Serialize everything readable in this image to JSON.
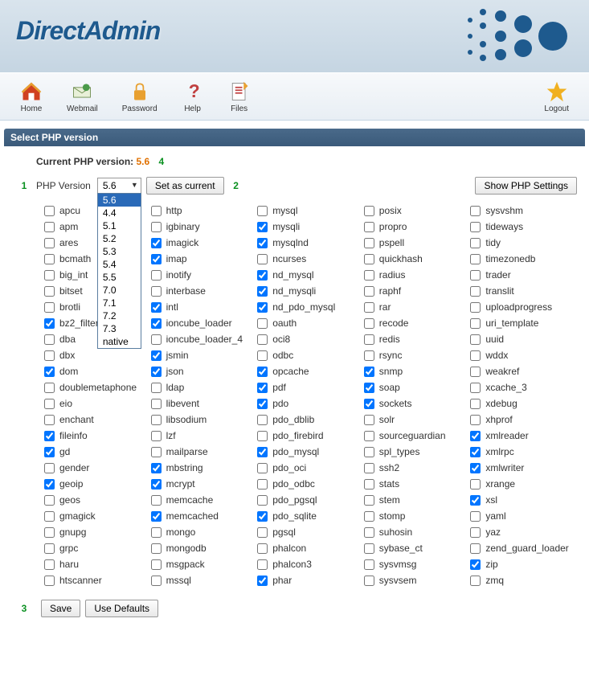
{
  "brand": "DirectAdmin",
  "toolbar": {
    "home": "Home",
    "webmail": "Webmail",
    "password": "Password",
    "help": "Help",
    "files": "Files",
    "logout": "Logout"
  },
  "panel": {
    "title": "Select PHP version"
  },
  "current": {
    "label": "Current PHP version:",
    "value": "5.6"
  },
  "markers": {
    "m1": "1",
    "m2": "2",
    "m3": "3",
    "m4": "4"
  },
  "selector": {
    "label": "PHP Version",
    "value": "5.6",
    "options": [
      "5.6",
      "4.4",
      "5.1",
      "5.2",
      "5.3",
      "5.4",
      "5.5",
      "7.0",
      "7.1",
      "7.2",
      "7.3",
      "native"
    ]
  },
  "buttons": {
    "set_current": "Set as current",
    "show_settings": "Show PHP Settings",
    "save": "Save",
    "use_defaults": "Use Defaults"
  },
  "extensions": {
    "col1": [
      {
        "name": "apcu",
        "checked": false
      },
      {
        "name": "apm",
        "checked": false
      },
      {
        "name": "ares",
        "checked": false
      },
      {
        "name": "bcmath",
        "checked": false
      },
      {
        "name": "big_int",
        "checked": false
      },
      {
        "name": "bitset",
        "checked": false
      },
      {
        "name": "brotli",
        "checked": false
      },
      {
        "name": "bz2_filter",
        "checked": true
      },
      {
        "name": "dba",
        "checked": false
      },
      {
        "name": "dbx",
        "checked": false
      },
      {
        "name": "dom",
        "checked": true
      },
      {
        "name": "doublemetaphone",
        "checked": false
      },
      {
        "name": "eio",
        "checked": false
      },
      {
        "name": "enchant",
        "checked": false
      },
      {
        "name": "fileinfo",
        "checked": true
      },
      {
        "name": "gd",
        "checked": true
      },
      {
        "name": "gender",
        "checked": false
      },
      {
        "name": "geoip",
        "checked": true
      },
      {
        "name": "geos",
        "checked": false
      },
      {
        "name": "gmagick",
        "checked": false
      },
      {
        "name": "gnupg",
        "checked": false
      },
      {
        "name": "grpc",
        "checked": false
      },
      {
        "name": "haru",
        "checked": false
      },
      {
        "name": "htscanner",
        "checked": false
      }
    ],
    "col2": [
      {
        "name": "http",
        "checked": false
      },
      {
        "name": "igbinary",
        "checked": false
      },
      {
        "name": "imagick",
        "checked": true
      },
      {
        "name": "imap",
        "checked": true
      },
      {
        "name": "inotify",
        "checked": false
      },
      {
        "name": "interbase",
        "checked": false
      },
      {
        "name": "intl",
        "checked": true
      },
      {
        "name": "ioncube_loader",
        "checked": true
      },
      {
        "name": "ioncube_loader_4",
        "checked": false
      },
      {
        "name": "jsmin",
        "checked": true
      },
      {
        "name": "json",
        "checked": true
      },
      {
        "name": "ldap",
        "checked": false
      },
      {
        "name": "libevent",
        "checked": false
      },
      {
        "name": "libsodium",
        "checked": false
      },
      {
        "name": "lzf",
        "checked": false
      },
      {
        "name": "mailparse",
        "checked": false
      },
      {
        "name": "mbstring",
        "checked": true
      },
      {
        "name": "mcrypt",
        "checked": true
      },
      {
        "name": "memcache",
        "checked": false
      },
      {
        "name": "memcached",
        "checked": true
      },
      {
        "name": "mongo",
        "checked": false
      },
      {
        "name": "mongodb",
        "checked": false
      },
      {
        "name": "msgpack",
        "checked": false
      },
      {
        "name": "mssql",
        "checked": false
      }
    ],
    "col3": [
      {
        "name": "mysql",
        "checked": false
      },
      {
        "name": "mysqli",
        "checked": true
      },
      {
        "name": "mysqlnd",
        "checked": true
      },
      {
        "name": "ncurses",
        "checked": false
      },
      {
        "name": "nd_mysql",
        "checked": true
      },
      {
        "name": "nd_mysqli",
        "checked": true
      },
      {
        "name": "nd_pdo_mysql",
        "checked": true
      },
      {
        "name": "oauth",
        "checked": false
      },
      {
        "name": "oci8",
        "checked": false
      },
      {
        "name": "odbc",
        "checked": false
      },
      {
        "name": "opcache",
        "checked": true
      },
      {
        "name": "pdf",
        "checked": true
      },
      {
        "name": "pdo",
        "checked": true
      },
      {
        "name": "pdo_dblib",
        "checked": false
      },
      {
        "name": "pdo_firebird",
        "checked": false
      },
      {
        "name": "pdo_mysql",
        "checked": true
      },
      {
        "name": "pdo_oci",
        "checked": false
      },
      {
        "name": "pdo_odbc",
        "checked": false
      },
      {
        "name": "pdo_pgsql",
        "checked": false
      },
      {
        "name": "pdo_sqlite",
        "checked": true
      },
      {
        "name": "pgsql",
        "checked": false
      },
      {
        "name": "phalcon",
        "checked": false
      },
      {
        "name": "phalcon3",
        "checked": false
      },
      {
        "name": "phar",
        "checked": true
      }
    ],
    "col4": [
      {
        "name": "posix",
        "checked": false
      },
      {
        "name": "propro",
        "checked": false
      },
      {
        "name": "pspell",
        "checked": false
      },
      {
        "name": "quickhash",
        "checked": false
      },
      {
        "name": "radius",
        "checked": false
      },
      {
        "name": "raphf",
        "checked": false
      },
      {
        "name": "rar",
        "checked": false
      },
      {
        "name": "recode",
        "checked": false
      },
      {
        "name": "redis",
        "checked": false
      },
      {
        "name": "rsync",
        "checked": false
      },
      {
        "name": "snmp",
        "checked": true
      },
      {
        "name": "soap",
        "checked": true
      },
      {
        "name": "sockets",
        "checked": true
      },
      {
        "name": "solr",
        "checked": false
      },
      {
        "name": "sourceguardian",
        "checked": false
      },
      {
        "name": "spl_types",
        "checked": false
      },
      {
        "name": "ssh2",
        "checked": false
      },
      {
        "name": "stats",
        "checked": false
      },
      {
        "name": "stem",
        "checked": false
      },
      {
        "name": "stomp",
        "checked": false
      },
      {
        "name": "suhosin",
        "checked": false
      },
      {
        "name": "sybase_ct",
        "checked": false
      },
      {
        "name": "sysvmsg",
        "checked": false
      },
      {
        "name": "sysvsem",
        "checked": false
      }
    ],
    "col5": [
      {
        "name": "sysvshm",
        "checked": false
      },
      {
        "name": "tideways",
        "checked": false
      },
      {
        "name": "tidy",
        "checked": false
      },
      {
        "name": "timezonedb",
        "checked": false
      },
      {
        "name": "trader",
        "checked": false
      },
      {
        "name": "translit",
        "checked": false
      },
      {
        "name": "uploadprogress",
        "checked": false
      },
      {
        "name": "uri_template",
        "checked": false
      },
      {
        "name": "uuid",
        "checked": false
      },
      {
        "name": "wddx",
        "checked": false
      },
      {
        "name": "weakref",
        "checked": false
      },
      {
        "name": "xcache_3",
        "checked": false
      },
      {
        "name": "xdebug",
        "checked": false
      },
      {
        "name": "xhprof",
        "checked": false
      },
      {
        "name": "xmlreader",
        "checked": true
      },
      {
        "name": "xmlrpc",
        "checked": true
      },
      {
        "name": "xmlwriter",
        "checked": true
      },
      {
        "name": "xrange",
        "checked": false
      },
      {
        "name": "xsl",
        "checked": true
      },
      {
        "name": "yaml",
        "checked": false
      },
      {
        "name": "yaz",
        "checked": false
      },
      {
        "name": "zend_guard_loader",
        "checked": false
      },
      {
        "name": "zip",
        "checked": true
      },
      {
        "name": "zmq",
        "checked": false
      }
    ]
  }
}
